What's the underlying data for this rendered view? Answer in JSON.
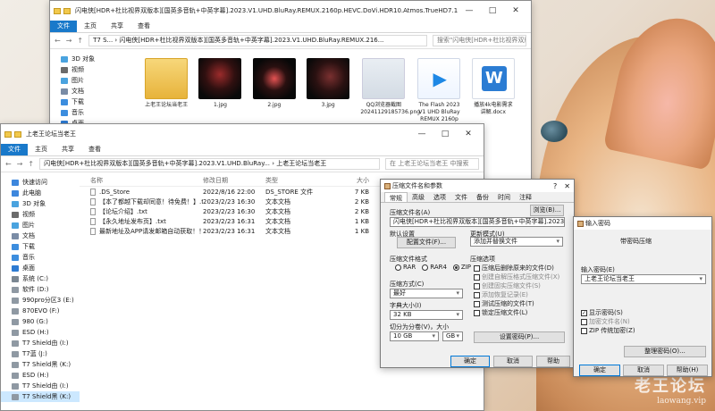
{
  "watermark": {
    "line1": "老王论坛",
    "line2": "laowang.vip"
  },
  "explorer_top": {
    "title": "闪电侠[HDR+杜比视界双版本][国英多音轨+中英字幕].2023.V1.UHD.BluRay.REMUX.2160p.HEVC.DoVi.HDR10.Atmos.TrueHD7.1.2Au",
    "tabs": [
      "文件",
      "主页",
      "共享",
      "查看"
    ],
    "path": "T7 S... › 闪电侠[HDR+杜比视界双版本][国英多音轨+中英字幕].2023.V1.UHD.BluRay.REMUX.216...",
    "search": "搜索\"闪电侠[HDR+杜比视界双版本][国英多音轨+中英字幕]...",
    "nav": [
      {
        "label": "3D 对象",
        "color": "#4aa3df"
      },
      {
        "label": "视频",
        "color": "#6b6b6b"
      },
      {
        "label": "图片",
        "color": "#4aa3df"
      },
      {
        "label": "文档",
        "color": "#7a8ca6"
      },
      {
        "label": "下载",
        "color": "#3c8dde"
      },
      {
        "label": "音乐",
        "color": "#3c8dde"
      },
      {
        "label": "桌面",
        "color": "#2d7bd2"
      },
      {
        "label": "系统 (C:)",
        "color": "#7b8792"
      }
    ],
    "items": [
      {
        "label": "上老王论坛当老王",
        "kind": "folder"
      },
      {
        "label": "1.jpg",
        "kind": "dark1"
      },
      {
        "label": "2.jpg",
        "kind": "dark2"
      },
      {
        "label": "3.jpg",
        "kind": "dark3"
      },
      {
        "label": "QQ浏览器截图20241129185736.png",
        "kind": "photo"
      },
      {
        "label": "The Flash 2023 V1 UHD BluRay REMUX 2160p HEVC DoVi H...",
        "kind": "video"
      },
      {
        "label": "播放4k电影需求讲解.docx",
        "kind": "docx"
      }
    ]
  },
  "explorer_bottom": {
    "title": "上老王论坛当老王",
    "tabs": [
      "文件",
      "主页",
      "共享",
      "查看"
    ],
    "path": "闪电侠[HDR+杜比视界双版本][国英多音轨+中英字幕].2023.V1.UHD.BluRay... › 上老王论坛当老王",
    "search": "在 上老王论坛当老王 中搜索",
    "nav": [
      {
        "label": "快速访问",
        "color": "#3d87dd"
      },
      {
        "label": "此电脑",
        "color": "#3d87dd"
      },
      {
        "label": "3D 对象",
        "color": "#4aa3df"
      },
      {
        "label": "视频",
        "color": "#6b6b6b"
      },
      {
        "label": "图片",
        "color": "#4aa3df"
      },
      {
        "label": "文档",
        "color": "#7a8ca6"
      },
      {
        "label": "下载",
        "color": "#3c8dde"
      },
      {
        "label": "音乐",
        "color": "#3c8dde"
      },
      {
        "label": "桌面",
        "color": "#2d7bd2"
      },
      {
        "label": "系统 (C:)",
        "color": "#7b8792"
      },
      {
        "label": "软件 (D:)",
        "color": "#8f99a3"
      },
      {
        "label": "990pro分区3 (E:)",
        "color": "#8f99a3"
      },
      {
        "label": "870EVO (F:)",
        "color": "#8f99a3"
      },
      {
        "label": "980 (G:)",
        "color": "#8f99a3"
      },
      {
        "label": "ESD (H:)",
        "color": "#8f99a3"
      },
      {
        "label": "T7 Shield由 (I:)",
        "color": "#8f99a3"
      },
      {
        "label": "T7蓝 (J:)",
        "color": "#8f99a3"
      },
      {
        "label": "T7 Shield黑 (K:)",
        "color": "#8f99a3"
      },
      {
        "label": "ESD (H:)",
        "color": "#8f99a3"
      },
      {
        "label": "T7 Shield由 (I:)",
        "color": "#8f99a3"
      },
      {
        "label": "T7 Shield黑 (K:)",
        "color": "#8f99a3"
      }
    ],
    "headers": [
      "名称",
      "修改日期",
      "类型",
      "大小"
    ],
    "files": [
      {
        "name": ".DS_Store",
        "date": "2022/8/16 22:00",
        "type": "DS_STORE 文件",
        "size": "7 KB"
      },
      {
        "name": "【本了都越下载却同意！待免费！】.txt",
        "date": "2023/2/23 16:30",
        "type": "文本文档",
        "size": "2 KB"
      },
      {
        "name": "【论坛介绍】.txt",
        "date": "2023/2/23 16:30",
        "type": "文本文档",
        "size": "2 KB"
      },
      {
        "name": "【永久地址发布页】.txt",
        "date": "2023/2/23 16:31",
        "type": "文本文档",
        "size": "1 KB"
      },
      {
        "name": "最新地址及APP请发邮箱自动获取！！！.txt",
        "date": "2023/2/23 16:31",
        "type": "文本文档",
        "size": "1 KB"
      }
    ]
  },
  "archive_dialog": {
    "title": "压缩文件名和参数",
    "tabs": [
      "常规",
      "高级",
      "选项",
      "文件",
      "备份",
      "时间",
      "注释"
    ],
    "name_label": "压缩文件名(A)",
    "browse": "浏览(B)...",
    "archive_name": "闪电侠[HDR+杜比视界双版本][国英多音轨+中英字幕].2023.V1.UHD.BluRay.RE",
    "default_label": "默认设置",
    "profiles": "配置文件(F)...",
    "update_label": "更新模式(U)",
    "update_value": "添加并替换文件",
    "format_label": "压缩文件格式",
    "formats": [
      "RAR",
      "RAR4",
      "ZIP"
    ],
    "options_label": "压缩选项",
    "options": [
      {
        "label": "压缩后删除原来的文件(D)",
        "checked": false
      },
      {
        "label": "创建自解压格式压缩文件(X)",
        "checked": false
      },
      {
        "label": "创建固实压缩文件(S)",
        "checked": false
      },
      {
        "label": "添加恢复记录(E)",
        "checked": false
      },
      {
        "label": "测试压缩的文件(T)",
        "checked": false
      },
      {
        "label": "锁定压缩文件(L)",
        "checked": false
      }
    ],
    "method_label": "压缩方式(C)",
    "method_value": "最好",
    "dict_label": "字典大小(I)",
    "dict_value": "32 KB",
    "split_label": "切分为分卷(V)，大小",
    "split_value": "10 GB",
    "split_unit": "GB",
    "password_button": "设置密码(P)...",
    "ok": "确定",
    "cancel": "取消",
    "help": "帮助"
  },
  "password_dialog": {
    "title": "输入密码",
    "heading": "带密码压缩",
    "input_label": "输入密码(E)",
    "password": "上老王论坛当老王",
    "options": [
      {
        "label": "显示密码(S)",
        "checked": true
      },
      {
        "label": "加密文件名(N)",
        "checked": false
      },
      {
        "label": "ZIP 传统加密(Z)",
        "checked": false
      }
    ],
    "organize": "整理密码(O)...",
    "ok": "确定",
    "cancel": "取消",
    "help": "帮助(H)"
  }
}
